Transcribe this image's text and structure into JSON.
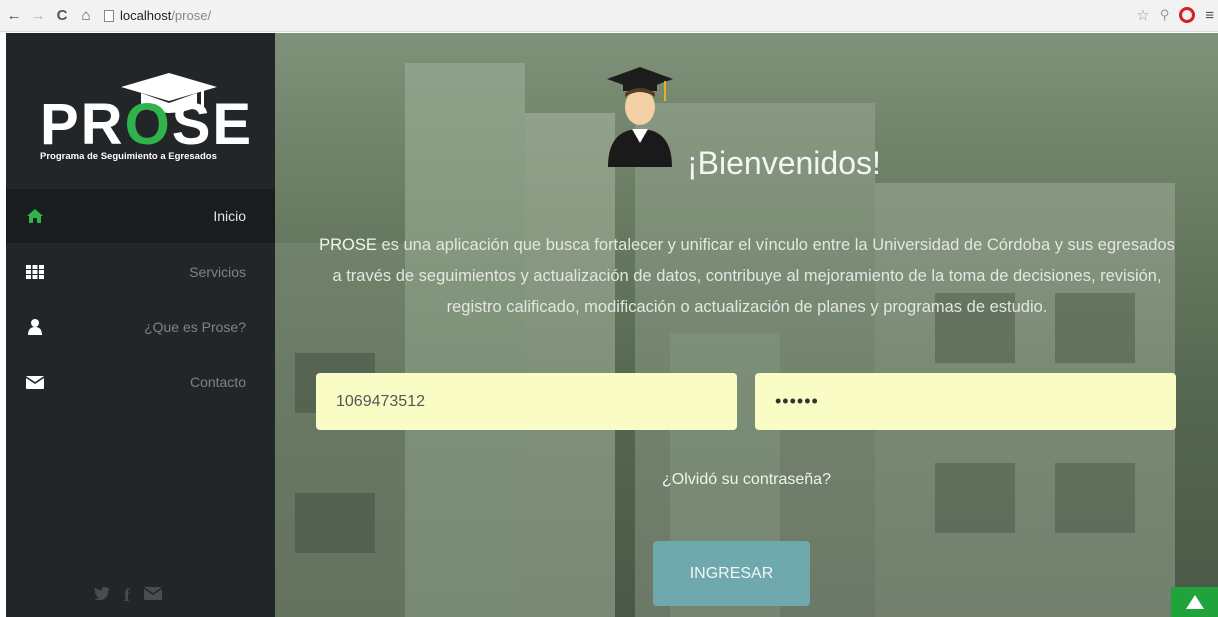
{
  "browser": {
    "url_host": "localhost",
    "url_path": "/prose/"
  },
  "brand": {
    "logo_letters_1": "PR",
    "logo_letter_o": "O",
    "logo_letters_2": "SE",
    "subtitle": "Programa de Seguimiento a Egresados"
  },
  "sidebar": {
    "items": [
      {
        "label": "Inicio",
        "icon": "home-icon",
        "active": true
      },
      {
        "label": "Servicios",
        "icon": "grid-icon",
        "active": false
      },
      {
        "label": "¿Que es Prose?",
        "icon": "user-icon",
        "active": false
      },
      {
        "label": "Contacto",
        "icon": "envelope-icon",
        "active": false
      }
    ]
  },
  "main": {
    "welcome": "¡Bienvenidos!",
    "desc_brand": "PROSE",
    "desc_text": " es una aplicación que busca fortalecer y unificar el vínculo entre la Universidad de Córdoba y sus egresados a través de seguimientos y actualización de datos, contribuye al mejoramiento de la toma de decisiones, revisión, registro calificado, modificación o actualización de planes y programas de estudio.",
    "username_value": "1069473512",
    "password_value": "••••••",
    "forgot_link": "¿Olvidó su contraseña?",
    "login_button": "INGRESAR"
  },
  "colors": {
    "accent_green": "#2fb34a",
    "sidebar_bg": "#222629",
    "input_bg": "#fafcc6",
    "button_bg": "#6fa8ad"
  }
}
